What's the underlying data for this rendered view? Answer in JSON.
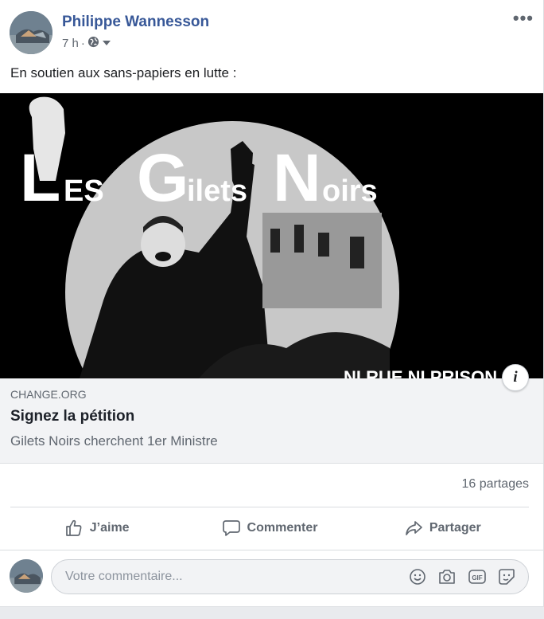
{
  "post": {
    "author": "Philippe Wannesson",
    "time": "7 h",
    "separator": "·",
    "text": "En soutien aux sans-papiers en lutte :",
    "more_label": "•••"
  },
  "link_preview": {
    "image_alt_text": "Les Gilets Noirs",
    "image_bottom_text": "NI RUE NI PRISON",
    "domain": "CHANGE.ORG",
    "title": "Signez la pétition",
    "description": "Gilets Noirs cherchent 1er Ministre",
    "info_label": "i"
  },
  "stats": {
    "shares": "16 partages"
  },
  "actions": {
    "like": "J’aime",
    "comment": "Commenter",
    "share": "Partager"
  },
  "comment_box": {
    "placeholder": "Votre commentaire..."
  },
  "icons": [
    "globe-icon",
    "chevron-down-icon",
    "thumbs-up-icon",
    "comment-icon",
    "share-arrow-icon",
    "smiley-icon",
    "camera-icon",
    "gif-icon",
    "sticker-icon",
    "more-options-icon",
    "info-icon"
  ],
  "colors": {
    "author_link": "#385898",
    "secondary_text": "#606770",
    "link_box_bg": "#f2f3f5"
  }
}
